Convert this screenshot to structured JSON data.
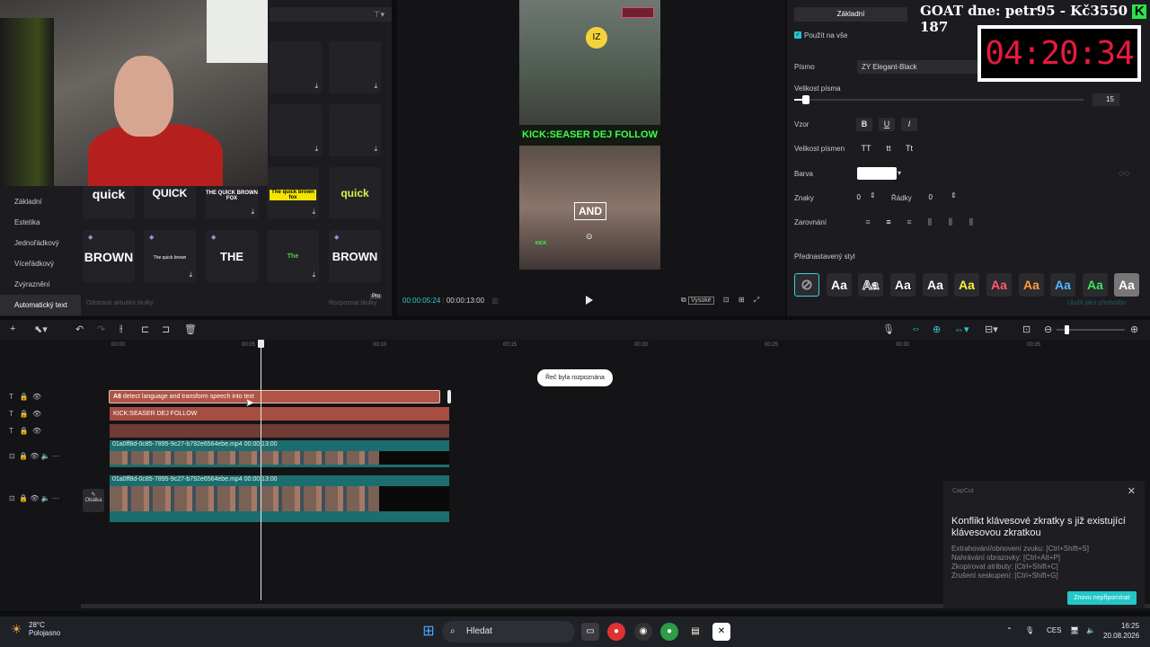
{
  "overlay": {
    "goat_text": "GOAT dne: petr95 - Kč3550",
    "goat_k": "K",
    "goat_count": "187",
    "timer": "04:20:34"
  },
  "left_panel": {
    "categories": [
      "Základní",
      "Estetika",
      "Jednořádkový",
      "Víceřádkový",
      "Zvýraznění",
      "Automatický text"
    ],
    "active_category": "Automatický text",
    "tiles_row1": [
      "quick",
      "QUICK",
      "THE QUICK BROWN FOX",
      "The quick brown fox",
      "quick"
    ],
    "tiles_row2": [
      "BROWN",
      "The quick brown",
      "THE",
      "The",
      "BROWN"
    ],
    "bottom_left": "Odstranit aktuální titulky",
    "bottom_right": "Rozpoznat titulky",
    "pro_badge": "Pro"
  },
  "preview": {
    "banner": "KICK:SEASER DEJ FOLLOW",
    "overlay_word": "AND",
    "emoji_text": "IZ",
    "time_current": "00:00:05:24",
    "time_total": "00:00:13:00",
    "quality": "Vysoké",
    "tiktok_label": "KICK"
  },
  "right_panel": {
    "tab": "Základní",
    "apply_all": "Použít na vše",
    "font_label": "Písmo",
    "font_value": "ZY Elegant-Black",
    "size_label": "Velikost písma",
    "size_value": "15",
    "style_label": "Vzor",
    "style_buttons": [
      "B",
      "U",
      "I"
    ],
    "case_label": "Velikost písmen",
    "case_buttons": [
      "TT",
      "tt",
      "Tt"
    ],
    "color_label": "Barva",
    "chars_label": "Znaky",
    "chars_value": "0",
    "lines_label": "Řádky",
    "lines_value": "0",
    "align_label": "Zarovnání",
    "preset_label": "Přednastavený styl",
    "preset_sample": "Aa",
    "save_preset": "Uložit jako předvolbu"
  },
  "timeline": {
    "ruler": [
      "00:00",
      "00:05",
      "00:10",
      "00:15",
      "00:20",
      "00:25",
      "00:30",
      "00:35"
    ],
    "clip_text1": "detect language and transform speech into text",
    "clip_text1_badge": "A8",
    "clip_text2": "KICK:SEASER DEJ FOLLOW",
    "video1_label": "01a0ff8d-0c85-7895-9c27-b792e6564ebe.mp4   00:00:13:00",
    "video2_label": "01a0ff8d-0c85-7895-9c27-b792e6564ebe.mp4   00:00:13:00",
    "tooltip": "Řeč byla rozpoznána",
    "cover": "Obálka"
  },
  "notification": {
    "app": "CapCut",
    "title": "Konflikt klávesové zkratky s již existující klávesovou zkratkou",
    "lines": [
      "Extrahování/obnovení zvuku: [Ctrl+Shift+S]",
      "Nahrávání obrazovky: [Ctrl+Alt+P]",
      "Zkopírovat atributy: [Ctrl+Shift+C]",
      "Zrušení seskupení: [Ctrl+Shift+G]"
    ],
    "button": "Znovu nepřipomínat"
  },
  "taskbar": {
    "temp": "28°C",
    "weather": "Polojasno",
    "search": "Hledat",
    "lang": "CES",
    "time": "16:25",
    "date": "20.08.2026"
  }
}
